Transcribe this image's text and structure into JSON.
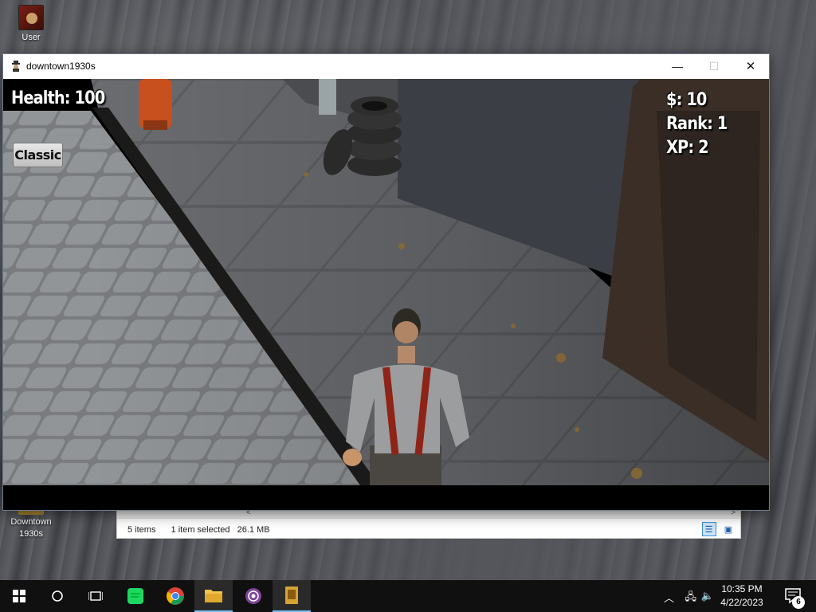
{
  "desktop": {
    "icons": [
      {
        "label": "User"
      },
      {
        "label": "Downtown 1930s"
      }
    ]
  },
  "explorer": {
    "status_items": "5 items",
    "status_selected": "1 item selected",
    "status_size": "26.1 MB"
  },
  "window": {
    "title": "downtown1930s",
    "minimize": "—",
    "maximize": "☐",
    "close": "✕"
  },
  "hud": {
    "health": "Health: 100",
    "money": "$: 10",
    "rank": "Rank: 1",
    "xp": "XP: 2",
    "mode_button": "Classic"
  },
  "taskbar": {
    "time": "10:35 PM",
    "date": "4/22/2023",
    "notification_count": "6",
    "apps": [
      "windows-start",
      "search",
      "task-view",
      "green-app",
      "chrome",
      "file-explorer",
      "tor-browser",
      "game-app"
    ]
  },
  "colors": {
    "taskbar": "#101010",
    "accent": "#76b9ed",
    "suspenders": "#8e2418"
  }
}
